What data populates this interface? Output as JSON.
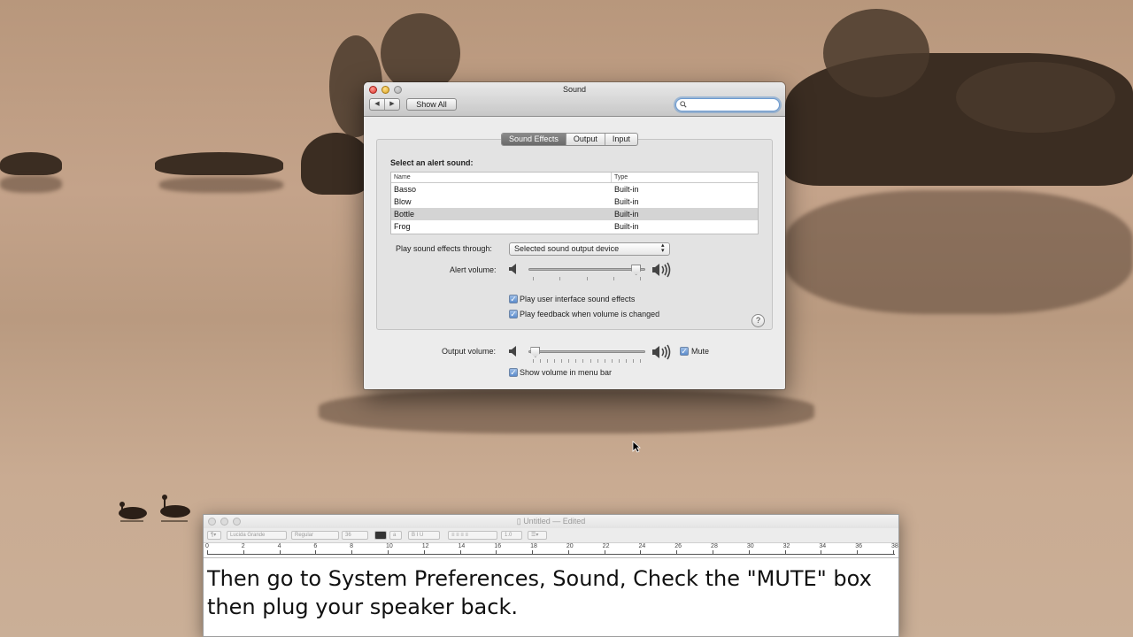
{
  "window": {
    "title": "Sound",
    "show_all": "Show All",
    "search_placeholder": "",
    "nav_back": "◀",
    "nav_forward": "▶"
  },
  "tabs": [
    {
      "label": "Sound Effects",
      "active": true
    },
    {
      "label": "Output",
      "active": false
    },
    {
      "label": "Input",
      "active": false
    }
  ],
  "sound_effects": {
    "select_label": "Select an alert sound:",
    "columns": [
      "Name",
      "Type"
    ],
    "rows": [
      {
        "name": "Basso",
        "type": "Built-in",
        "selected": false
      },
      {
        "name": "Blow",
        "type": "Built-in",
        "selected": false
      },
      {
        "name": "Bottle",
        "type": "Built-in",
        "selected": true
      },
      {
        "name": "Frog",
        "type": "Built-in",
        "selected": false
      }
    ],
    "play_through_label": "Play sound effects through:",
    "play_through_value": "Selected sound output device",
    "alert_volume_label": "Alert volume:",
    "alert_volume_level": 0.96,
    "ui_sounds_label": "Play user interface sound effects",
    "ui_sounds_checked": true,
    "feedback_label": "Play feedback when volume is changed",
    "feedback_checked": true,
    "help": "?"
  },
  "output": {
    "volume_label": "Output volume:",
    "volume_level": 0.02,
    "mute_label": "Mute",
    "mute_checked": true,
    "menu_bar_label": "Show volume in menu bar",
    "menu_bar_checked": true
  },
  "textedit": {
    "title": "Untitled",
    "title_suffix": "— Edited",
    "font_name": "Lucida Grande",
    "font_style": "Regular",
    "font_size": "36",
    "line_spacing": "1.0",
    "ruler_marks": [
      "0",
      "2",
      "4",
      "6",
      "8",
      "10",
      "12",
      "14",
      "16",
      "18",
      "20",
      "22",
      "24",
      "26",
      "28",
      "30",
      "32",
      "34",
      "36",
      "38"
    ],
    "body_line1": "Then go to System Preferences, Sound, Check the \"MUTE\" box",
    "body_line2": "then plug your speaker back."
  },
  "colors": {
    "selection": "#d4d4d4",
    "active_tab": "#7a7a7a",
    "checkbox": "#5c8ccc",
    "focus_ring": "#6c9ad0"
  }
}
